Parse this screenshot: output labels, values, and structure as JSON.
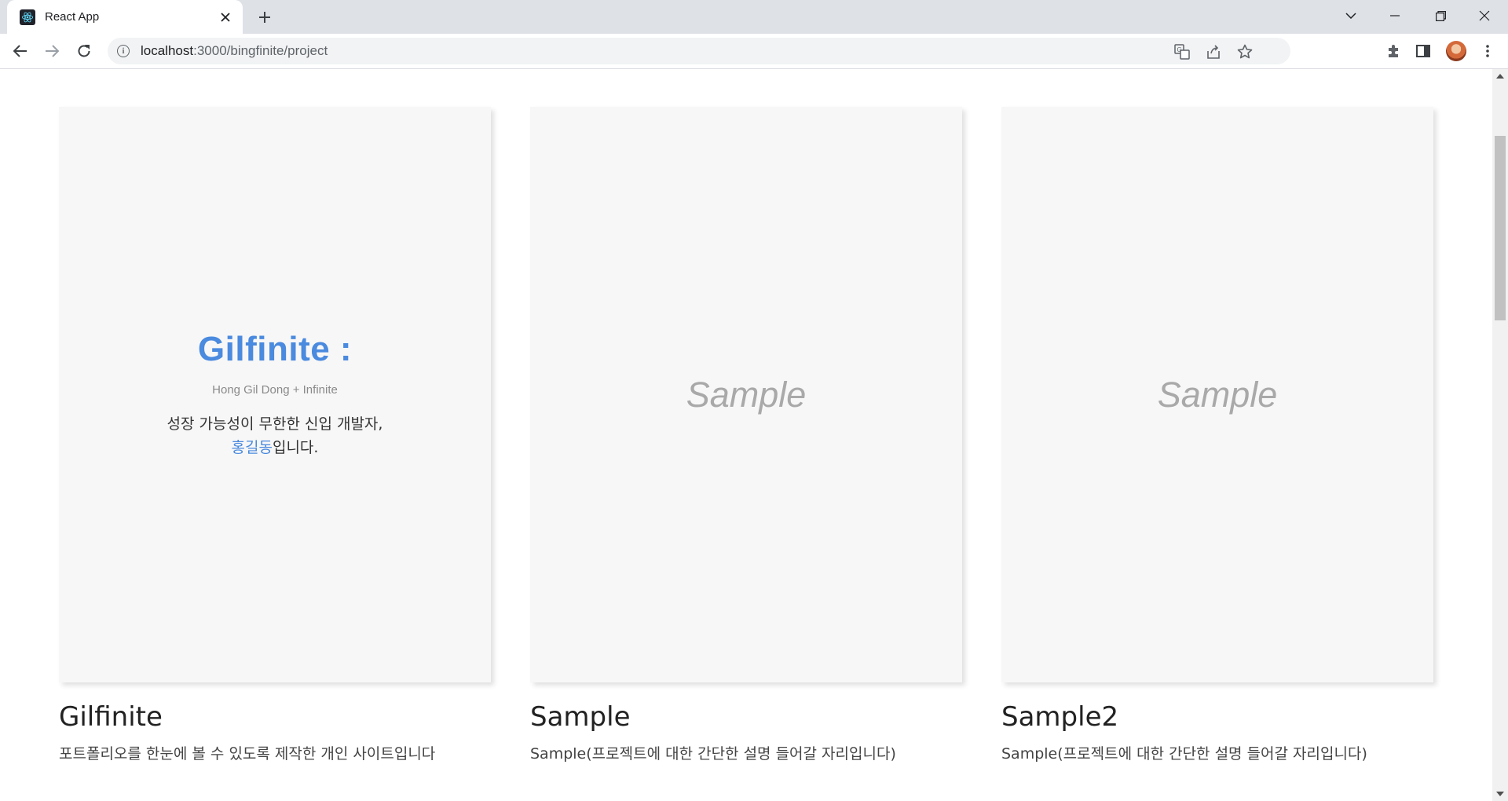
{
  "browser": {
    "tab_title": "React App",
    "url_host": "localhost",
    "url_rest": ":3000/bingfinite/project"
  },
  "projects": [
    {
      "title": "Gilfinite",
      "description": "포트폴리오를 한눈에 볼 수 있도록 제작한 개인 사이트입니다",
      "thumb": {
        "headline": "Gilfinite :",
        "subtitle": "Hong Gil Dong + Infinite",
        "line1": "성장 가능성이 무한한 신입 개발자,",
        "highlight": "홍길동",
        "line2_rest": "입니다."
      }
    },
    {
      "title": "Sample",
      "description": "Sample(프로젝트에 대한 간단한 설명 들어갈 자리입니다)",
      "thumb_text": "Sample"
    },
    {
      "title": "Sample2",
      "description": "Sample(프로젝트에 대한 간단한 설명 들어갈 자리입니다)",
      "thumb_text": "Sample"
    }
  ],
  "colors": {
    "accent": "#4a8adf",
    "thumb_bg": "#f7f7f7",
    "sample_text": "#a9a9a9"
  },
  "icons": [
    "react-favicon",
    "close-icon",
    "plus-icon",
    "chevron-down-icon",
    "minimize-icon",
    "restore-icon",
    "window-close-icon",
    "back-icon",
    "forward-icon",
    "reload-icon",
    "info-icon",
    "translate-icon",
    "share-icon",
    "star-icon",
    "extensions-icon",
    "side-panel-icon",
    "avatar",
    "more-icon"
  ]
}
